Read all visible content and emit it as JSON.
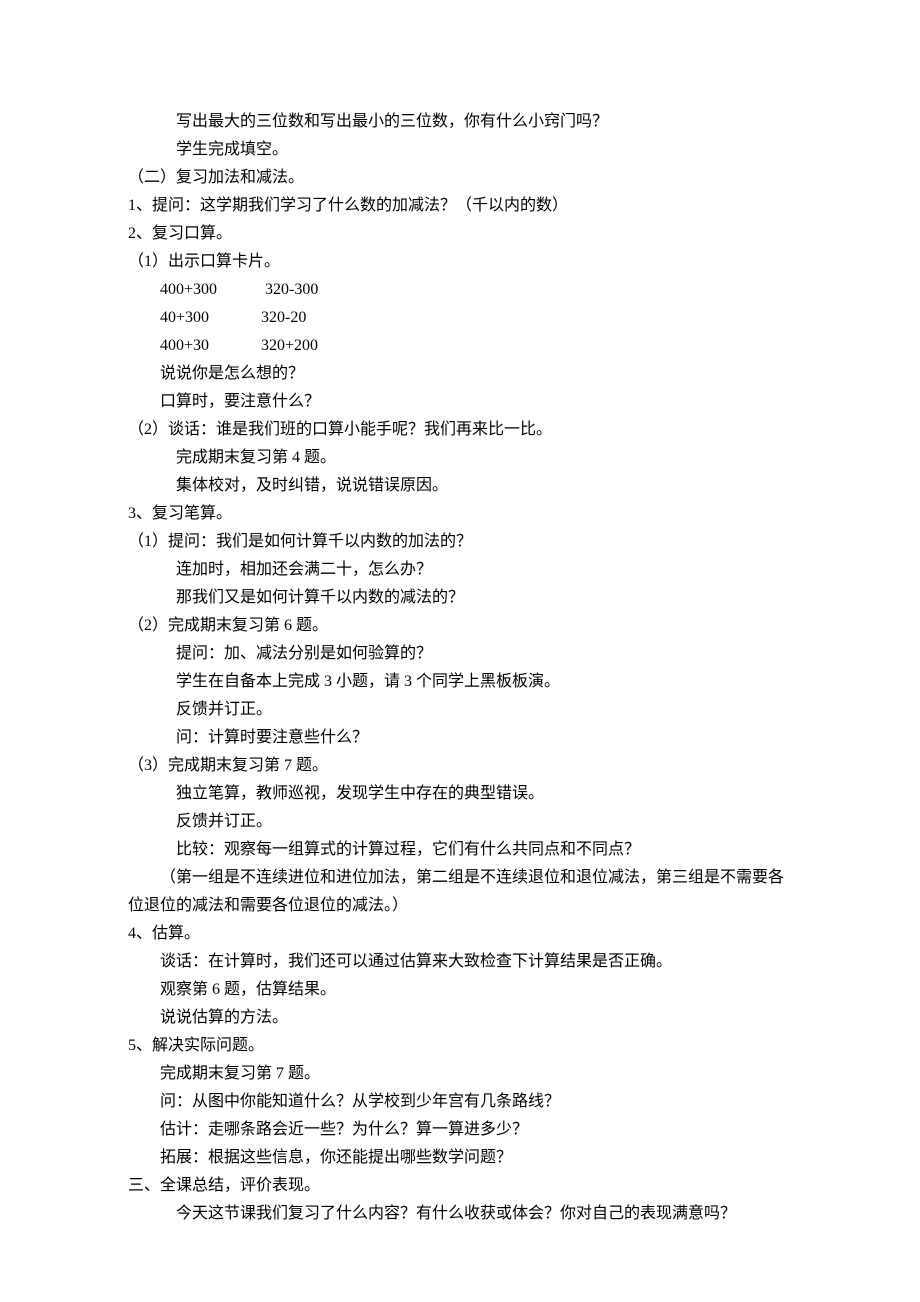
{
  "lines": [
    {
      "indent": 3,
      "text": "写出最大的三位数和写出最小的三位数，你有什么小窍门吗？"
    },
    {
      "indent": 3,
      "text": "学生完成填空。"
    },
    {
      "indent": 0,
      "text": "（二）复习加法和减法。"
    },
    {
      "indent": 0,
      "text": "1、提问：这学期我们学习了什么数的加减法？（千以内的数）"
    },
    {
      "indent": 0,
      "text": "2、复习口算。"
    },
    {
      "indent": 0,
      "text": "（1）出示口算卡片。"
    },
    {
      "indent": 2,
      "text": "400+300            320-300"
    },
    {
      "indent": 2,
      "text": "40+300             320-20"
    },
    {
      "indent": 2,
      "text": "400+30             320+200"
    },
    {
      "indent": 2,
      "text": "说说你是怎么想的？"
    },
    {
      "indent": 2,
      "text": "口算时，要注意什么？"
    },
    {
      "indent": 0,
      "text": "（2）谈话：谁是我们班的口算小能手呢？我们再来比一比。"
    },
    {
      "indent": 3,
      "text": "完成期末复习第 4 题。"
    },
    {
      "indent": 3,
      "text": "集体校对，及时纠错，说说错误原因。"
    },
    {
      "indent": 0,
      "text": "3、复习笔算。"
    },
    {
      "indent": 0,
      "text": "（1）提问：我们是如何计算千以内数的加法的？"
    },
    {
      "indent": 3,
      "text": "连加时，相加还会满二十，怎么办？"
    },
    {
      "indent": 3,
      "text": "那我们又是如何计算千以内数的减法的？"
    },
    {
      "indent": 0,
      "text": "（2）完成期末复习第 6 题。"
    },
    {
      "indent": 3,
      "text": "提问：加、减法分别是如何验算的？"
    },
    {
      "indent": 3,
      "text": "学生在自备本上完成 3 小题，请 3 个同学上黑板板演。"
    },
    {
      "indent": 3,
      "text": "反馈并订正。"
    },
    {
      "indent": 3,
      "text": "问：计算时要注意些什么？"
    },
    {
      "indent": 0,
      "text": "（3）完成期末复习第 7 题。"
    },
    {
      "indent": 3,
      "text": "独立笔算，教师巡视，发现学生中存在的典型错误。"
    },
    {
      "indent": 3,
      "text": "反馈并订正。"
    },
    {
      "indent": 3,
      "text": "比较：观察每一组算式的计算过程，它们有什么共同点和不同点？"
    },
    {
      "indent": 2,
      "text": "（第一组是不连续进位和进位加法，第二组是不连续退位和退位减法，第三组是不需要各"
    },
    {
      "indent": 0,
      "text": "位退位的减法和需要各位退位的减法。）"
    },
    {
      "indent": 0,
      "text": "4、估算。"
    },
    {
      "indent": 2,
      "text": "谈话：在计算时，我们还可以通过估算来大致检查下计算结果是否正确。"
    },
    {
      "indent": 2,
      "text": "观察第 6 题，估算结果。"
    },
    {
      "indent": 2,
      "text": "说说估算的方法。"
    },
    {
      "indent": 0,
      "text": "5、解决实际问题。"
    },
    {
      "indent": 2,
      "text": "完成期末复习第 7 题。"
    },
    {
      "indent": 2,
      "text": "问：从图中你能知道什么？从学校到少年宫有几条路线？"
    },
    {
      "indent": 2,
      "text": "估计：走哪条路会近一些？为什么？算一算进多少？"
    },
    {
      "indent": 2,
      "text": "拓展：根据这些信息，你还能提出哪些数学问题？"
    },
    {
      "indent": 0,
      "text": "三、全课总结，评价表现。"
    },
    {
      "indent": 3,
      "text": "今天这节课我们复习了什么内容？有什么收获或体会？你对自己的表现满意吗？"
    }
  ]
}
